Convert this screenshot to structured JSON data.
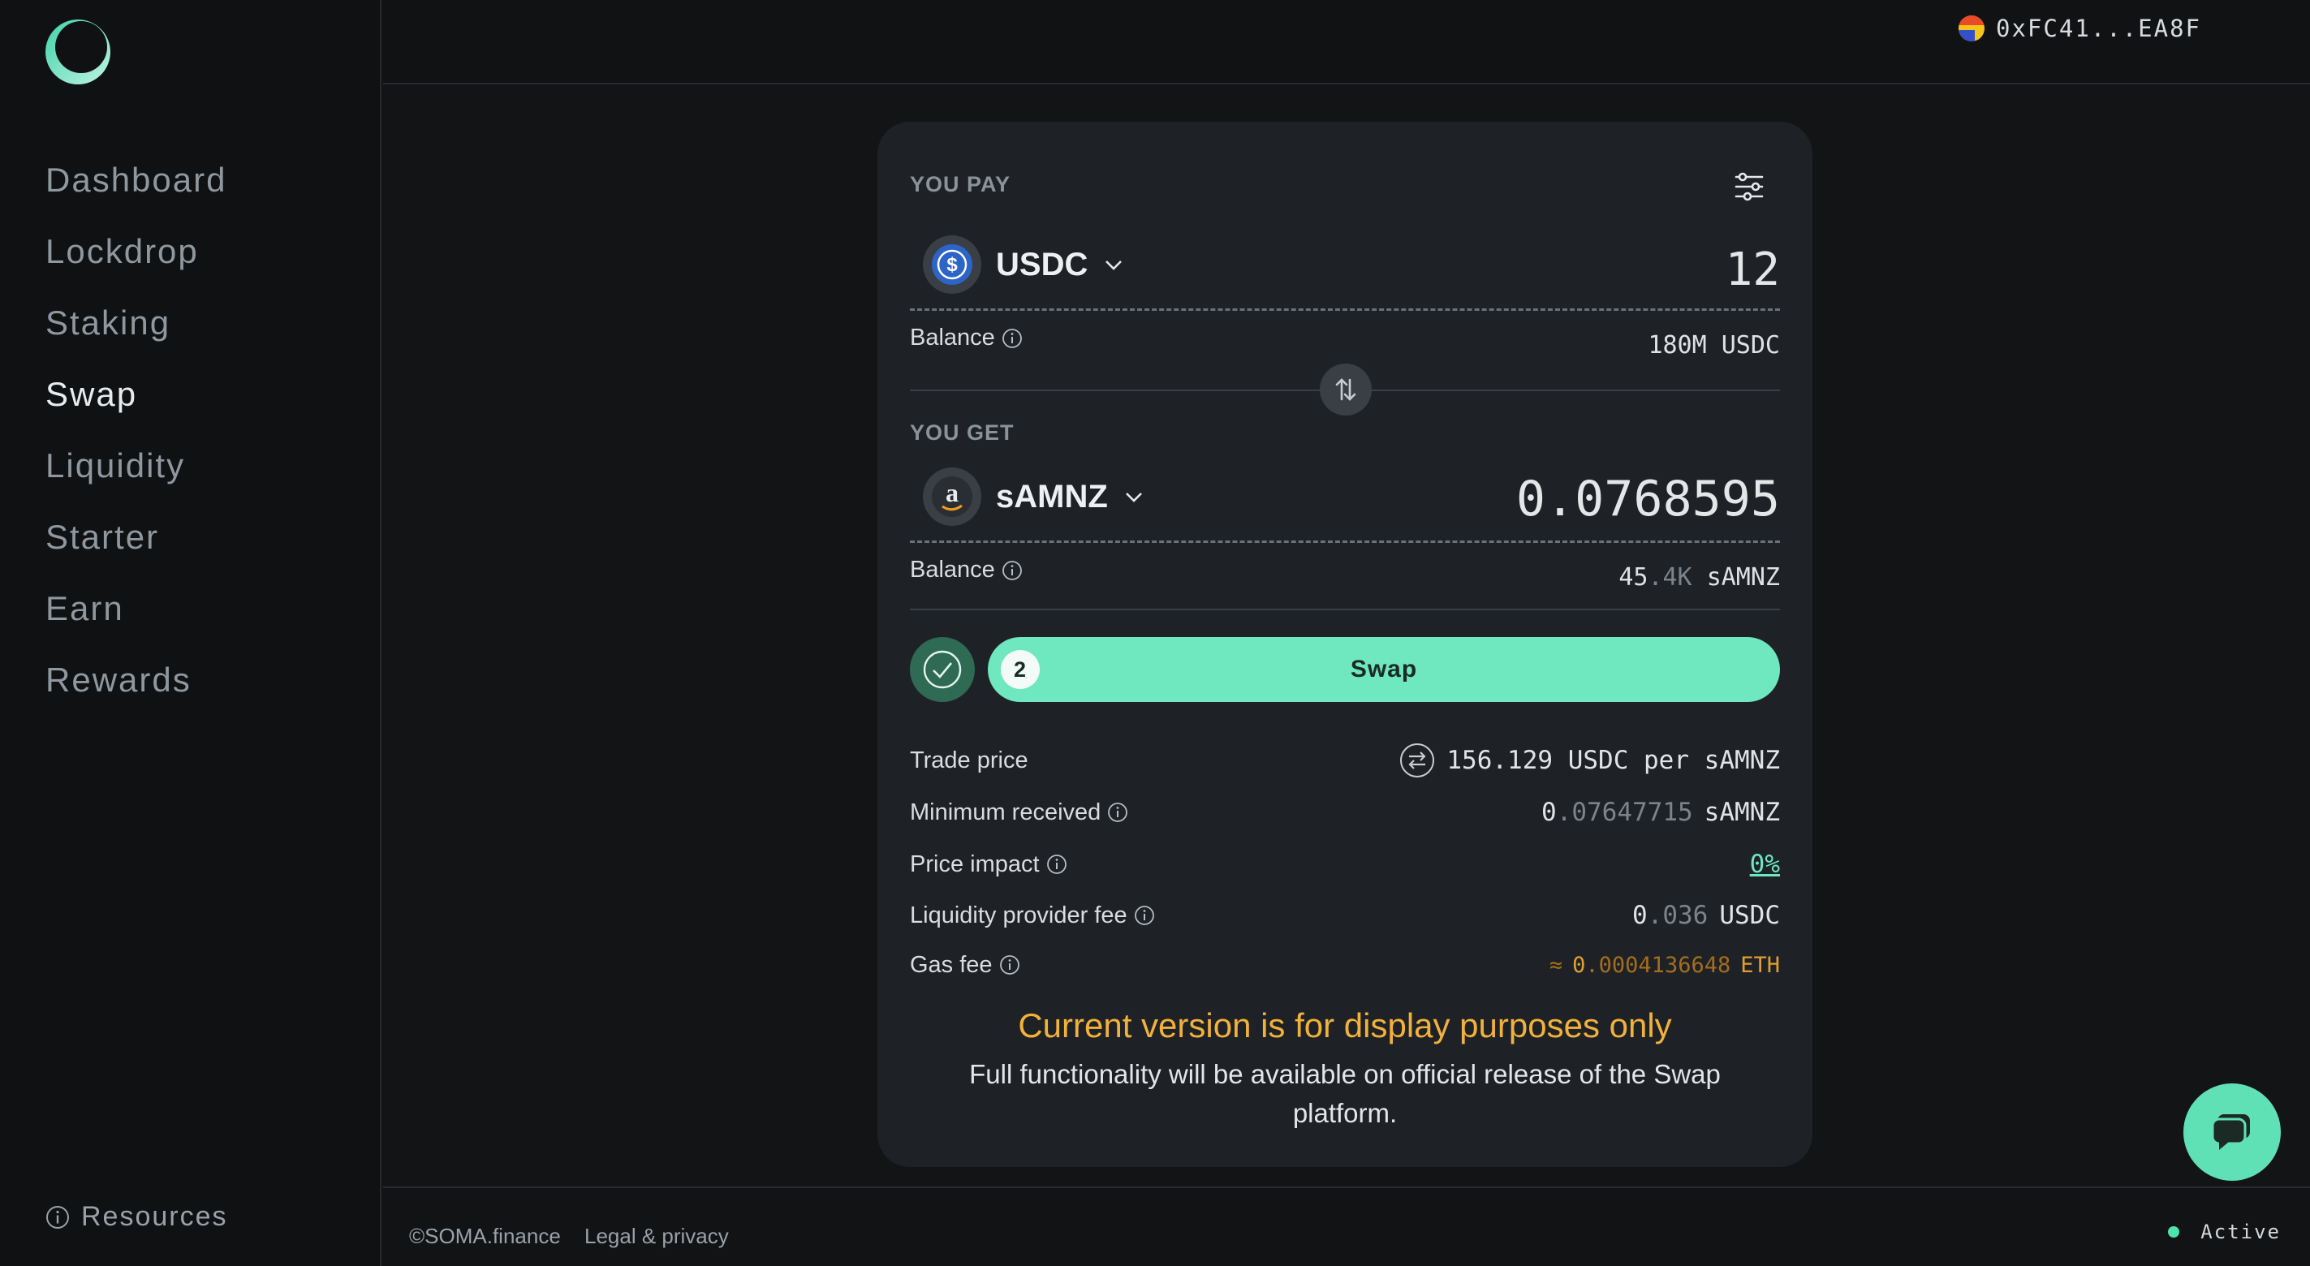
{
  "wallet": {
    "address": "0xFC41...EA8F"
  },
  "sidebar": {
    "items": [
      {
        "label": "Dashboard"
      },
      {
        "label": "Lockdrop"
      },
      {
        "label": "Staking"
      },
      {
        "label": "Swap"
      },
      {
        "label": "Liquidity"
      },
      {
        "label": "Starter"
      },
      {
        "label": "Earn"
      },
      {
        "label": "Rewards"
      }
    ],
    "active": "Swap",
    "resources_label": "Resources"
  },
  "swap": {
    "pay": {
      "section_label": "YOU PAY",
      "token": "USDC",
      "amount": "12",
      "balance_label": "Balance",
      "balance_value": "180M",
      "balance_unit": "USDC"
    },
    "get": {
      "section_label": "YOU GET",
      "token": "sAMNZ",
      "amount": "0.0768595",
      "balance_label": "Balance",
      "balance_int": "45",
      "balance_frac": ".4K",
      "balance_unit": "sAMNZ"
    },
    "step_number": "2",
    "button_label": "Swap",
    "details": {
      "trade_price_label": "Trade price",
      "trade_price_value": "156.129 USDC per sAMNZ",
      "min_received_label": "Minimum received",
      "min_received_int": "0",
      "min_received_frac": ".07647715",
      "min_received_unit": "sAMNZ",
      "price_impact_label": "Price impact",
      "price_impact_value": "0%",
      "lp_fee_label": "Liquidity provider fee",
      "lp_fee_int": "0",
      "lp_fee_frac": ".036",
      "lp_fee_unit": "USDC",
      "gas_fee_label": "Gas fee",
      "gas_fee_approx": "≈",
      "gas_fee_int": "0",
      "gas_fee_frac": ".0004136648",
      "gas_fee_unit": "ETH"
    },
    "notice_title": "Current version is for display purposes only",
    "notice_body": "Full functionality will be available on official release of the Swap platform."
  },
  "footer": {
    "copyright": "©SOMA.finance",
    "legal": "Legal & privacy",
    "status": "Active"
  },
  "colors": {
    "accent": "#6fe7bf",
    "warning": "#f2b13a",
    "background": "#121416",
    "card": "#1e2226"
  }
}
